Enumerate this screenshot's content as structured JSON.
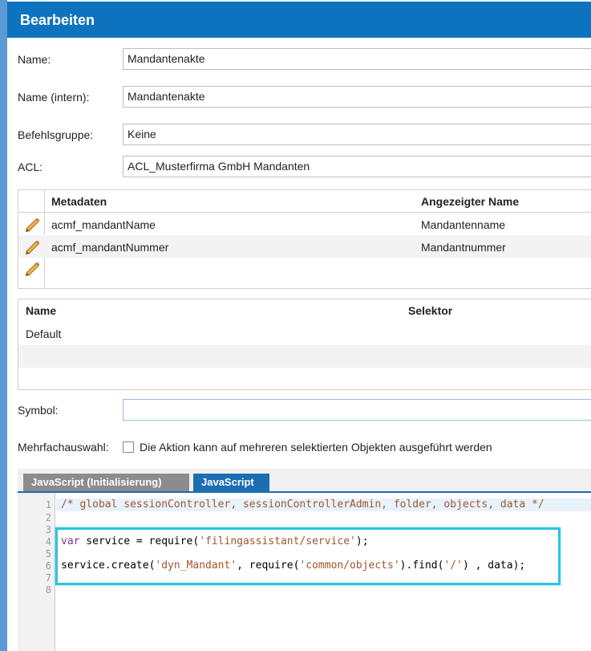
{
  "header": {
    "title": "Bearbeiten"
  },
  "form": {
    "name_label": "Name:",
    "name_value": "Mandantenakte",
    "name_intern_label": "Name (intern):",
    "name_intern_value": "Mandantenakte",
    "befehlsgruppe_label": "Befehlsgruppe:",
    "befehlsgruppe_value": "Keine",
    "acl_label": "ACL:",
    "acl_value": "ACL_Musterfirma GmbH Mandanten",
    "symbol_label": "Symbol:",
    "symbol_value": "",
    "mehrfach_label": "Mehrfachauswahl:",
    "mehrfach_text": "Die Aktion kann auf mehreren selektierten Objekten ausgeführt werden"
  },
  "metadata_table": {
    "columns": [
      "Metadaten",
      "Angezeigter Name"
    ],
    "rows": [
      {
        "meta": "acmf_mandantName",
        "display": "Mandantenname"
      },
      {
        "meta": "acmf_mandantNummer",
        "display": "Mandantnummer"
      },
      {
        "meta": "",
        "display": ""
      }
    ],
    "row_icon": "pencil-icon"
  },
  "selector_table": {
    "columns": [
      "Name",
      "Selektor"
    ],
    "rows": [
      {
        "name": "Default",
        "selector": ""
      }
    ]
  },
  "tabs": {
    "init_label": "JavaScript (Initialisierung)",
    "js_label": "JavaScript",
    "active": "JavaScript"
  },
  "editor": {
    "line_numbers": [
      "1",
      "2",
      "3",
      "4",
      "5",
      "6",
      "7",
      "8"
    ],
    "line1": "/* global sessionController, sessionControllerAdmin, folder, objects, data */",
    "line4": {
      "kw": "var",
      "a": " service = require(",
      "s": "'filingassistant/service'",
      "b": ");"
    },
    "line6": {
      "a": "service.create(",
      "s1": "'dyn_Mandant'",
      "b": ", require(",
      "s2": "'common/objects'",
      "c": ").find(",
      "s3": "'/'",
      "d": ") , data);"
    }
  },
  "colors": {
    "header": "#0e73bf",
    "tab_active": "#1d6db3",
    "highlight": "#2ec4e0"
  }
}
